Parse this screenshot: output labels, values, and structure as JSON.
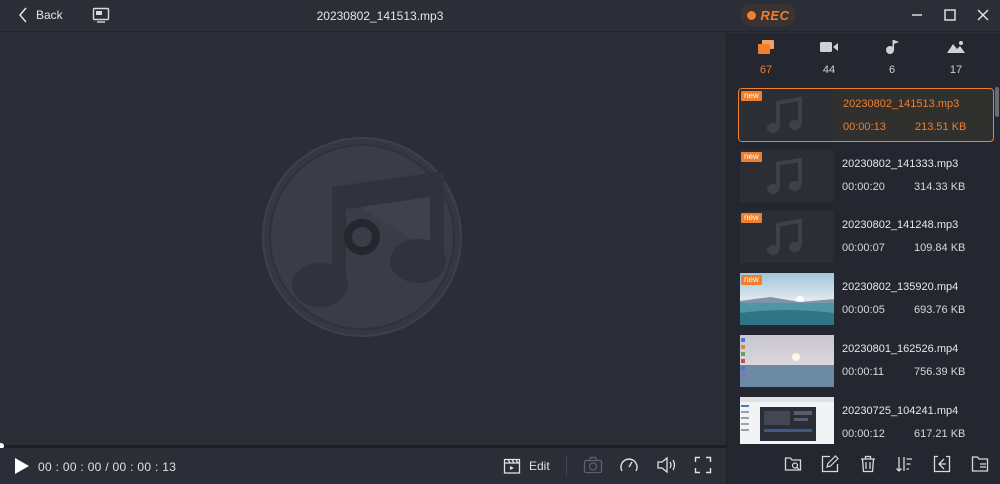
{
  "topbar": {
    "back_label": "Back",
    "title": "20230802_141513.mp3",
    "rec_label": "REC"
  },
  "player": {
    "time": "00 : 00 : 00 / 00 : 00 : 13",
    "edit_label": "Edit",
    "progress": 0
  },
  "sidebar": {
    "categories": [
      {
        "icon": "recordings-icon",
        "count": "67"
      },
      {
        "icon": "video-icon",
        "count": "44"
      },
      {
        "icon": "audio-icon",
        "count": "6"
      },
      {
        "icon": "image-icon",
        "count": "17"
      }
    ],
    "items": [
      {
        "badge": "new",
        "name": "20230802_141513.mp3",
        "duration": "00:00:13",
        "size": "213.51 KB",
        "kind": "audio"
      },
      {
        "badge": "new",
        "name": "20230802_141333.mp3",
        "duration": "00:00:20",
        "size": "314.33 KB",
        "kind": "audio"
      },
      {
        "badge": "new",
        "name": "20230802_141248.mp3",
        "duration": "00:00:07",
        "size": "109.84 KB",
        "kind": "audio"
      },
      {
        "badge": "new",
        "name": "20230802_135920.mp4",
        "duration": "00:00:05",
        "size": "693.76 KB",
        "kind": "video-landscape"
      },
      {
        "badge": "",
        "name": "20230801_162526.mp4",
        "duration": "00:00:11",
        "size": "756.39 KB",
        "kind": "video-desktop"
      },
      {
        "badge": "",
        "name": "20230725_104241.mp4",
        "duration": "00:00:12",
        "size": "617.21 KB",
        "kind": "video-window"
      }
    ]
  },
  "colors": {
    "accent": "#f07f2e",
    "background": "#2b2d37",
    "sidebar": "#252730"
  }
}
